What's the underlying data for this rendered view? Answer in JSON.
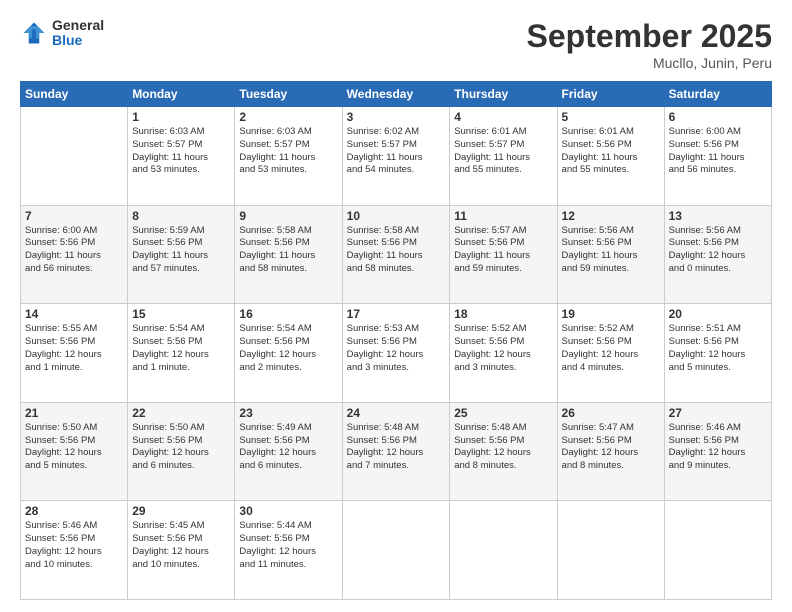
{
  "header": {
    "logo_general": "General",
    "logo_blue": "Blue",
    "month_title": "September 2025",
    "location": "Mucllo, Junin, Peru"
  },
  "calendar": {
    "days_of_week": [
      "Sunday",
      "Monday",
      "Tuesday",
      "Wednesday",
      "Thursday",
      "Friday",
      "Saturday"
    ],
    "weeks": [
      [
        {
          "day": "",
          "info": ""
        },
        {
          "day": "1",
          "info": "Sunrise: 6:03 AM\nSunset: 5:57 PM\nDaylight: 11 hours\nand 53 minutes."
        },
        {
          "day": "2",
          "info": "Sunrise: 6:03 AM\nSunset: 5:57 PM\nDaylight: 11 hours\nand 53 minutes."
        },
        {
          "day": "3",
          "info": "Sunrise: 6:02 AM\nSunset: 5:57 PM\nDaylight: 11 hours\nand 54 minutes."
        },
        {
          "day": "4",
          "info": "Sunrise: 6:01 AM\nSunset: 5:57 PM\nDaylight: 11 hours\nand 55 minutes."
        },
        {
          "day": "5",
          "info": "Sunrise: 6:01 AM\nSunset: 5:56 PM\nDaylight: 11 hours\nand 55 minutes."
        },
        {
          "day": "6",
          "info": "Sunrise: 6:00 AM\nSunset: 5:56 PM\nDaylight: 11 hours\nand 56 minutes."
        }
      ],
      [
        {
          "day": "7",
          "info": "Sunrise: 6:00 AM\nSunset: 5:56 PM\nDaylight: 11 hours\nand 56 minutes."
        },
        {
          "day": "8",
          "info": "Sunrise: 5:59 AM\nSunset: 5:56 PM\nDaylight: 11 hours\nand 57 minutes."
        },
        {
          "day": "9",
          "info": "Sunrise: 5:58 AM\nSunset: 5:56 PM\nDaylight: 11 hours\nand 58 minutes."
        },
        {
          "day": "10",
          "info": "Sunrise: 5:58 AM\nSunset: 5:56 PM\nDaylight: 11 hours\nand 58 minutes."
        },
        {
          "day": "11",
          "info": "Sunrise: 5:57 AM\nSunset: 5:56 PM\nDaylight: 11 hours\nand 59 minutes."
        },
        {
          "day": "12",
          "info": "Sunrise: 5:56 AM\nSunset: 5:56 PM\nDaylight: 11 hours\nand 59 minutes."
        },
        {
          "day": "13",
          "info": "Sunrise: 5:56 AM\nSunset: 5:56 PM\nDaylight: 12 hours\nand 0 minutes."
        }
      ],
      [
        {
          "day": "14",
          "info": "Sunrise: 5:55 AM\nSunset: 5:56 PM\nDaylight: 12 hours\nand 1 minute."
        },
        {
          "day": "15",
          "info": "Sunrise: 5:54 AM\nSunset: 5:56 PM\nDaylight: 12 hours\nand 1 minute."
        },
        {
          "day": "16",
          "info": "Sunrise: 5:54 AM\nSunset: 5:56 PM\nDaylight: 12 hours\nand 2 minutes."
        },
        {
          "day": "17",
          "info": "Sunrise: 5:53 AM\nSunset: 5:56 PM\nDaylight: 12 hours\nand 3 minutes."
        },
        {
          "day": "18",
          "info": "Sunrise: 5:52 AM\nSunset: 5:56 PM\nDaylight: 12 hours\nand 3 minutes."
        },
        {
          "day": "19",
          "info": "Sunrise: 5:52 AM\nSunset: 5:56 PM\nDaylight: 12 hours\nand 4 minutes."
        },
        {
          "day": "20",
          "info": "Sunrise: 5:51 AM\nSunset: 5:56 PM\nDaylight: 12 hours\nand 5 minutes."
        }
      ],
      [
        {
          "day": "21",
          "info": "Sunrise: 5:50 AM\nSunset: 5:56 PM\nDaylight: 12 hours\nand 5 minutes."
        },
        {
          "day": "22",
          "info": "Sunrise: 5:50 AM\nSunset: 5:56 PM\nDaylight: 12 hours\nand 6 minutes."
        },
        {
          "day": "23",
          "info": "Sunrise: 5:49 AM\nSunset: 5:56 PM\nDaylight: 12 hours\nand 6 minutes."
        },
        {
          "day": "24",
          "info": "Sunrise: 5:48 AM\nSunset: 5:56 PM\nDaylight: 12 hours\nand 7 minutes."
        },
        {
          "day": "25",
          "info": "Sunrise: 5:48 AM\nSunset: 5:56 PM\nDaylight: 12 hours\nand 8 minutes."
        },
        {
          "day": "26",
          "info": "Sunrise: 5:47 AM\nSunset: 5:56 PM\nDaylight: 12 hours\nand 8 minutes."
        },
        {
          "day": "27",
          "info": "Sunrise: 5:46 AM\nSunset: 5:56 PM\nDaylight: 12 hours\nand 9 minutes."
        }
      ],
      [
        {
          "day": "28",
          "info": "Sunrise: 5:46 AM\nSunset: 5:56 PM\nDaylight: 12 hours\nand 10 minutes."
        },
        {
          "day": "29",
          "info": "Sunrise: 5:45 AM\nSunset: 5:56 PM\nDaylight: 12 hours\nand 10 minutes."
        },
        {
          "day": "30",
          "info": "Sunrise: 5:44 AM\nSunset: 5:56 PM\nDaylight: 12 hours\nand 11 minutes."
        },
        {
          "day": "",
          "info": ""
        },
        {
          "day": "",
          "info": ""
        },
        {
          "day": "",
          "info": ""
        },
        {
          "day": "",
          "info": ""
        }
      ]
    ]
  }
}
